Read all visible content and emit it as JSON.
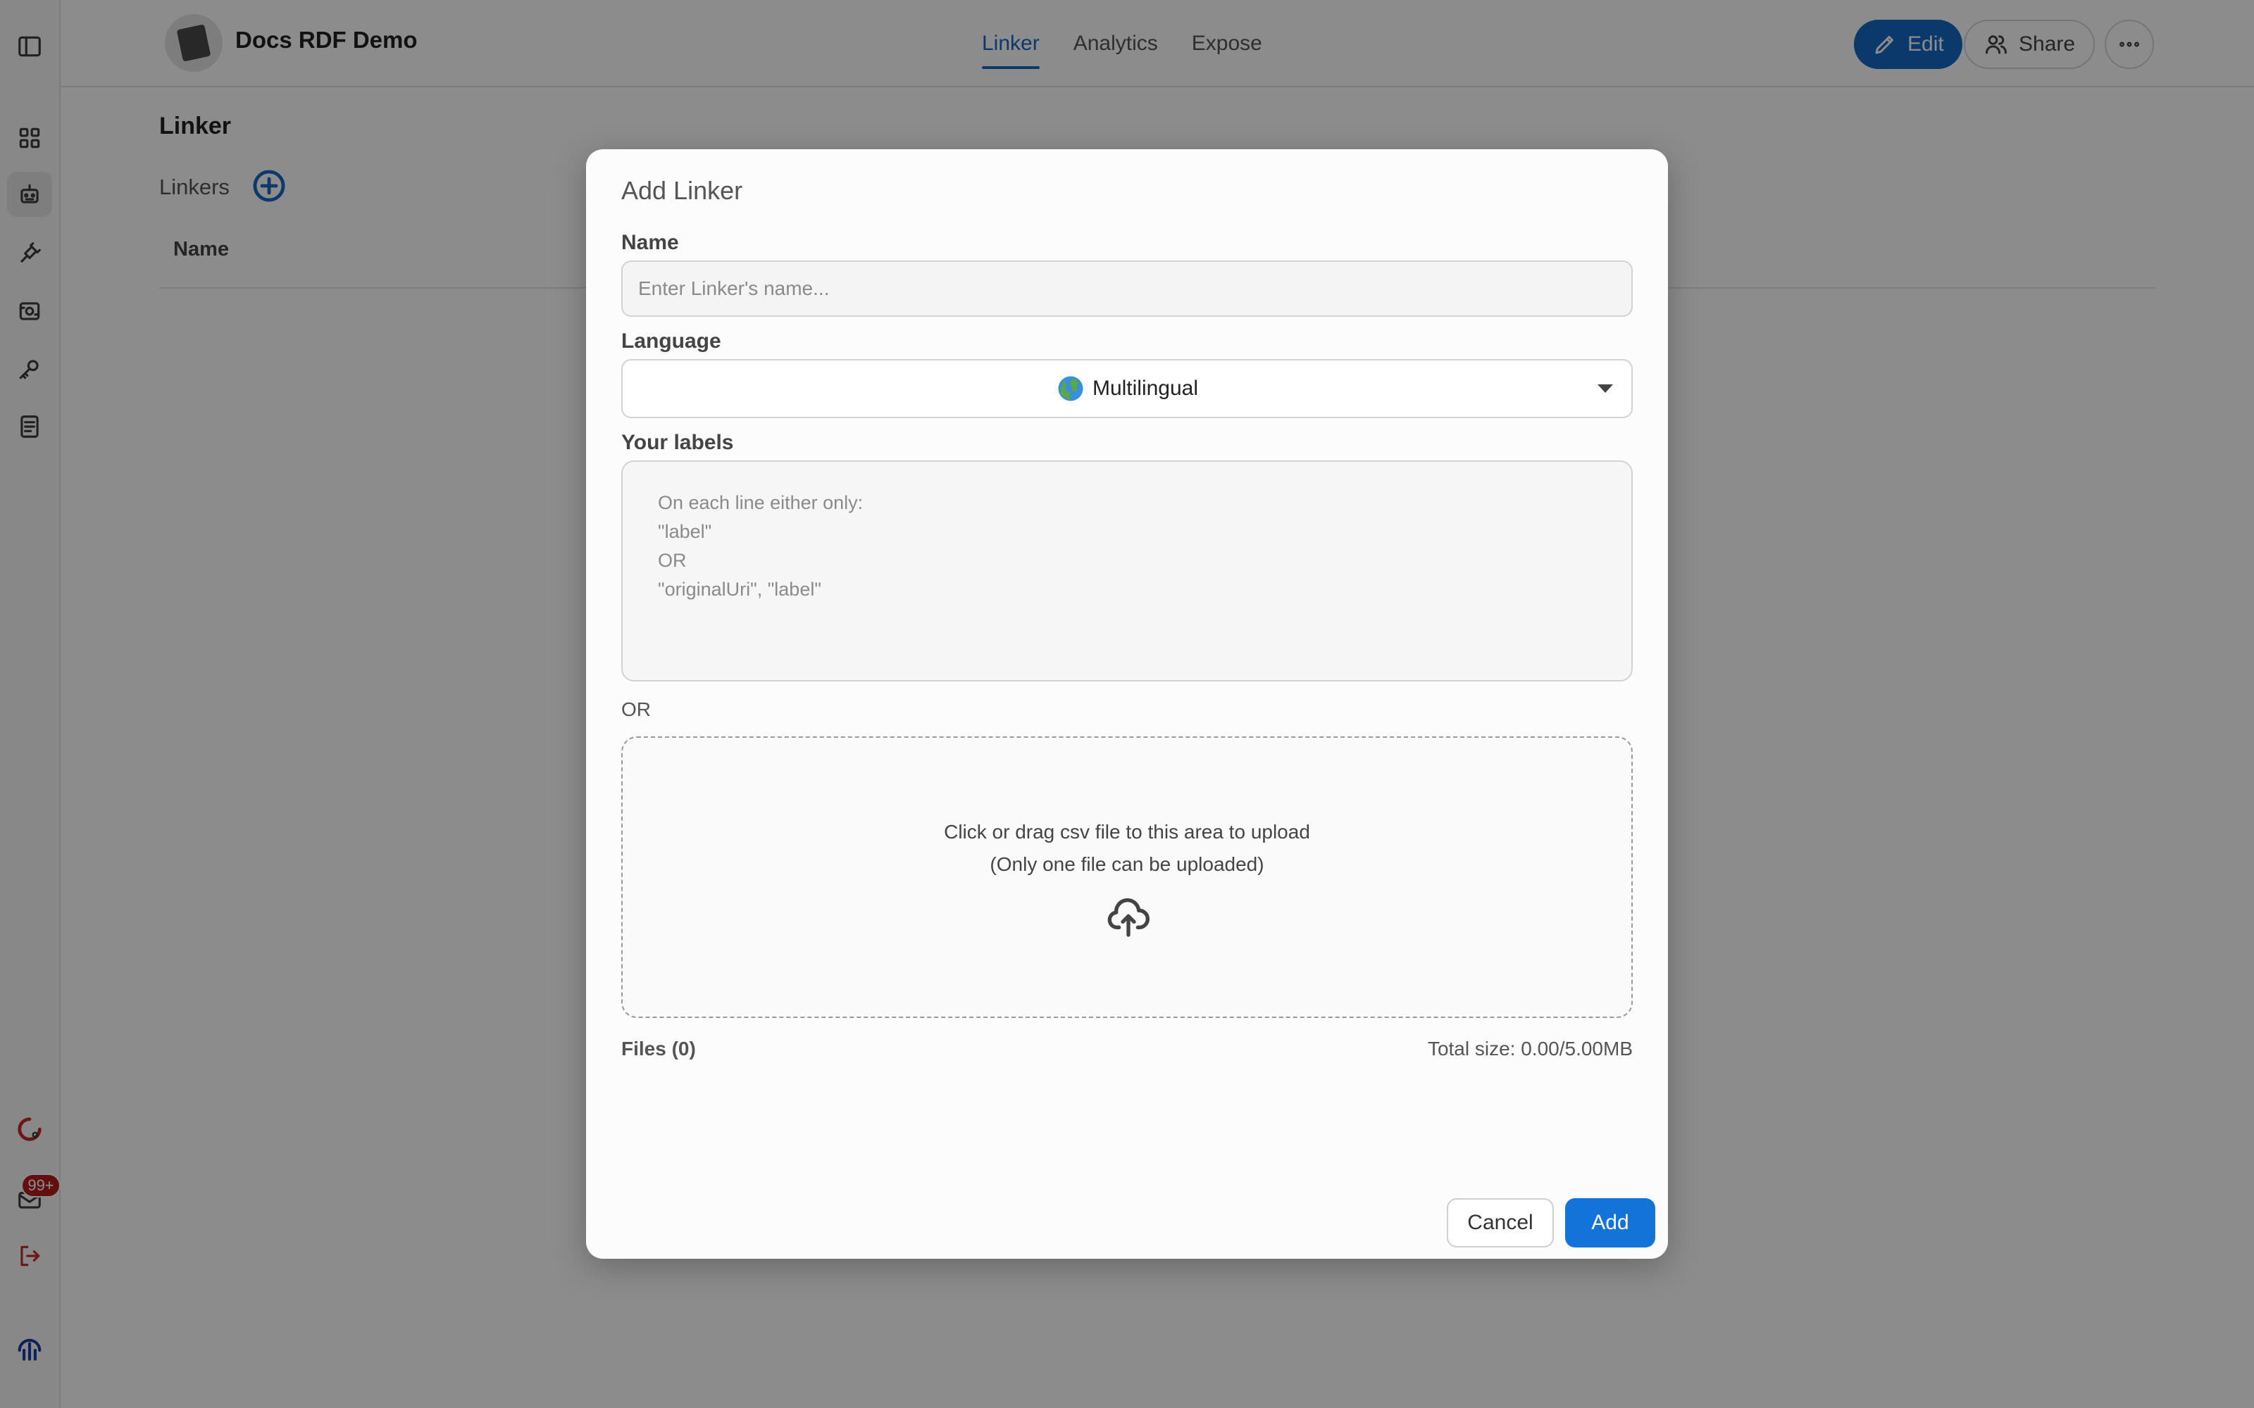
{
  "header": {
    "app_title": "Docs RDF Demo",
    "tabs": [
      {
        "label": "Linker",
        "active": true
      },
      {
        "label": "Analytics",
        "active": false
      },
      {
        "label": "Expose",
        "active": false
      }
    ],
    "edit_label": "Edit",
    "share_label": "Share"
  },
  "sidebar": {
    "icons": [
      "sidebar-toggle-icon",
      "grid-icon",
      "robot-icon",
      "plug-icon",
      "gallery-icon",
      "key-icon",
      "document-icon",
      "shield-logo-icon",
      "inbox-icon",
      "logout-icon",
      "brand-logo-icon"
    ],
    "notification_badge": "99+"
  },
  "page": {
    "heading": "Linker",
    "linkers_label": "Linkers",
    "table_header_name": "Name"
  },
  "modal": {
    "title": "Add Linker",
    "name_label": "Name",
    "name_placeholder": "Enter Linker's name...",
    "language_label": "Language",
    "language_value": "Multilingual",
    "labels_label": "Your labels",
    "labels_placeholder": [
      "On each line either only:",
      "\"label\"",
      "OR",
      "\"originalUri\", \"label\""
    ],
    "or_text": "OR",
    "dropzone_line1": "Click or drag csv file to this area to upload",
    "dropzone_line2": "(Only one file can be uploaded)",
    "files_count": "Files (0)",
    "total_size": "Total size: 0.00/5.00MB",
    "cancel_label": "Cancel",
    "add_label": "Add"
  },
  "colors": {
    "accent": "#1769c4",
    "primary_button": "#1473d8",
    "logout": "#c62828",
    "badge": "#b71c1c"
  }
}
